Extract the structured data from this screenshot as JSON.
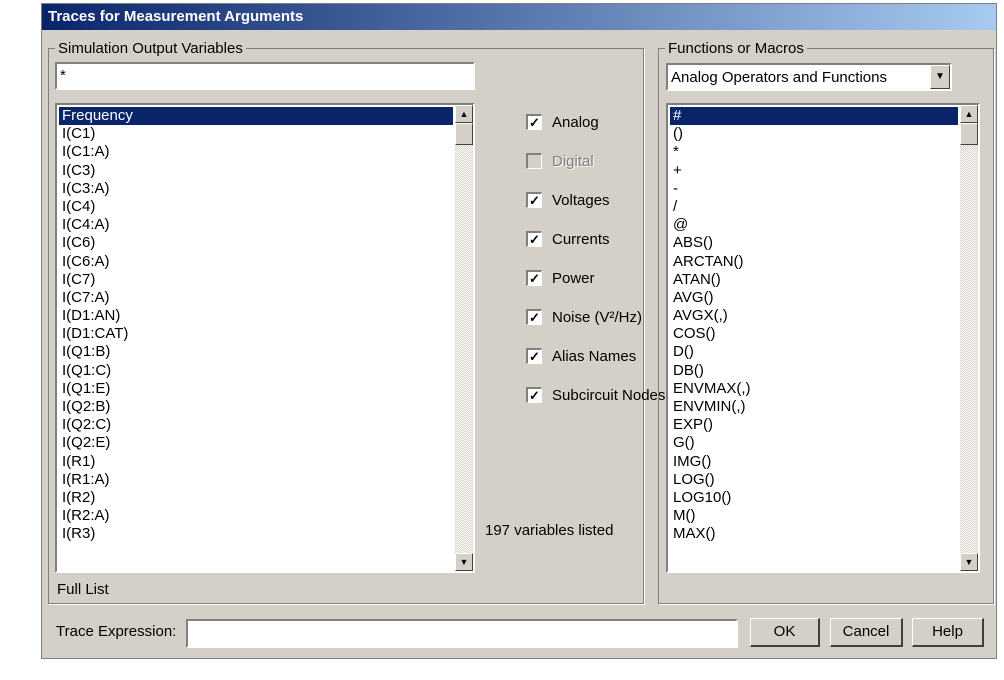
{
  "window": {
    "title": "Traces for Measurement Arguments"
  },
  "sim": {
    "legend": "Simulation Output Variables",
    "filter_value": "*",
    "items": [
      "Frequency",
      "I(C1)",
      "I(C1:A)",
      "I(C3)",
      "I(C3:A)",
      "I(C4)",
      "I(C4:A)",
      "I(C6)",
      "I(C6:A)",
      "I(C7)",
      "I(C7:A)",
      "I(D1:AN)",
      "I(D1:CAT)",
      "I(Q1:B)",
      "I(Q1:C)",
      "I(Q1:E)",
      "I(Q2:B)",
      "I(Q2:C)",
      "I(Q2:E)",
      "I(R1)",
      "I(R1:A)",
      "I(R2)",
      "I(R2:A)",
      "I(R3)"
    ],
    "selected_index": 0,
    "footer": "Full List"
  },
  "checkboxes": [
    {
      "label": "Analog",
      "checked": true,
      "enabled": true
    },
    {
      "label": "Digital",
      "checked": false,
      "enabled": false
    },
    {
      "label": "Voltages",
      "checked": true,
      "enabled": true
    },
    {
      "label": "Currents",
      "checked": true,
      "enabled": true
    },
    {
      "label": "Power",
      "checked": true,
      "enabled": true
    },
    {
      "label": "Noise (V²/Hz)",
      "checked": true,
      "enabled": true
    },
    {
      "label": "Alias Names",
      "checked": true,
      "enabled": true
    },
    {
      "label": "Subcircuit Nodes",
      "checked": true,
      "enabled": true
    }
  ],
  "count_text": "197 variables listed",
  "func": {
    "legend": "Functions or Macros",
    "dropdown_value": "Analog Operators and Functions",
    "items": [
      "#",
      "()",
      "*",
      "+",
      "-",
      "/",
      "@",
      "ABS()",
      "ARCTAN()",
      "ATAN()",
      "AVG()",
      "AVGX(,)",
      "COS()",
      "D()",
      "DB()",
      "ENVMAX(,)",
      "ENVMIN(,)",
      "EXP()",
      "G()",
      "IMG()",
      "LOG()",
      "LOG10()",
      "M()",
      "MAX()"
    ],
    "selected_index": 0
  },
  "trace": {
    "label": "Trace Expression:",
    "value": ""
  },
  "buttons": {
    "ok": "OK",
    "cancel": "Cancel",
    "help": "Help"
  },
  "icons": {
    "scroll_up": "arrow-up-icon",
    "scroll_down": "arrow-down-icon",
    "dropdown": "chevron-down-icon",
    "check": "check-icon"
  }
}
